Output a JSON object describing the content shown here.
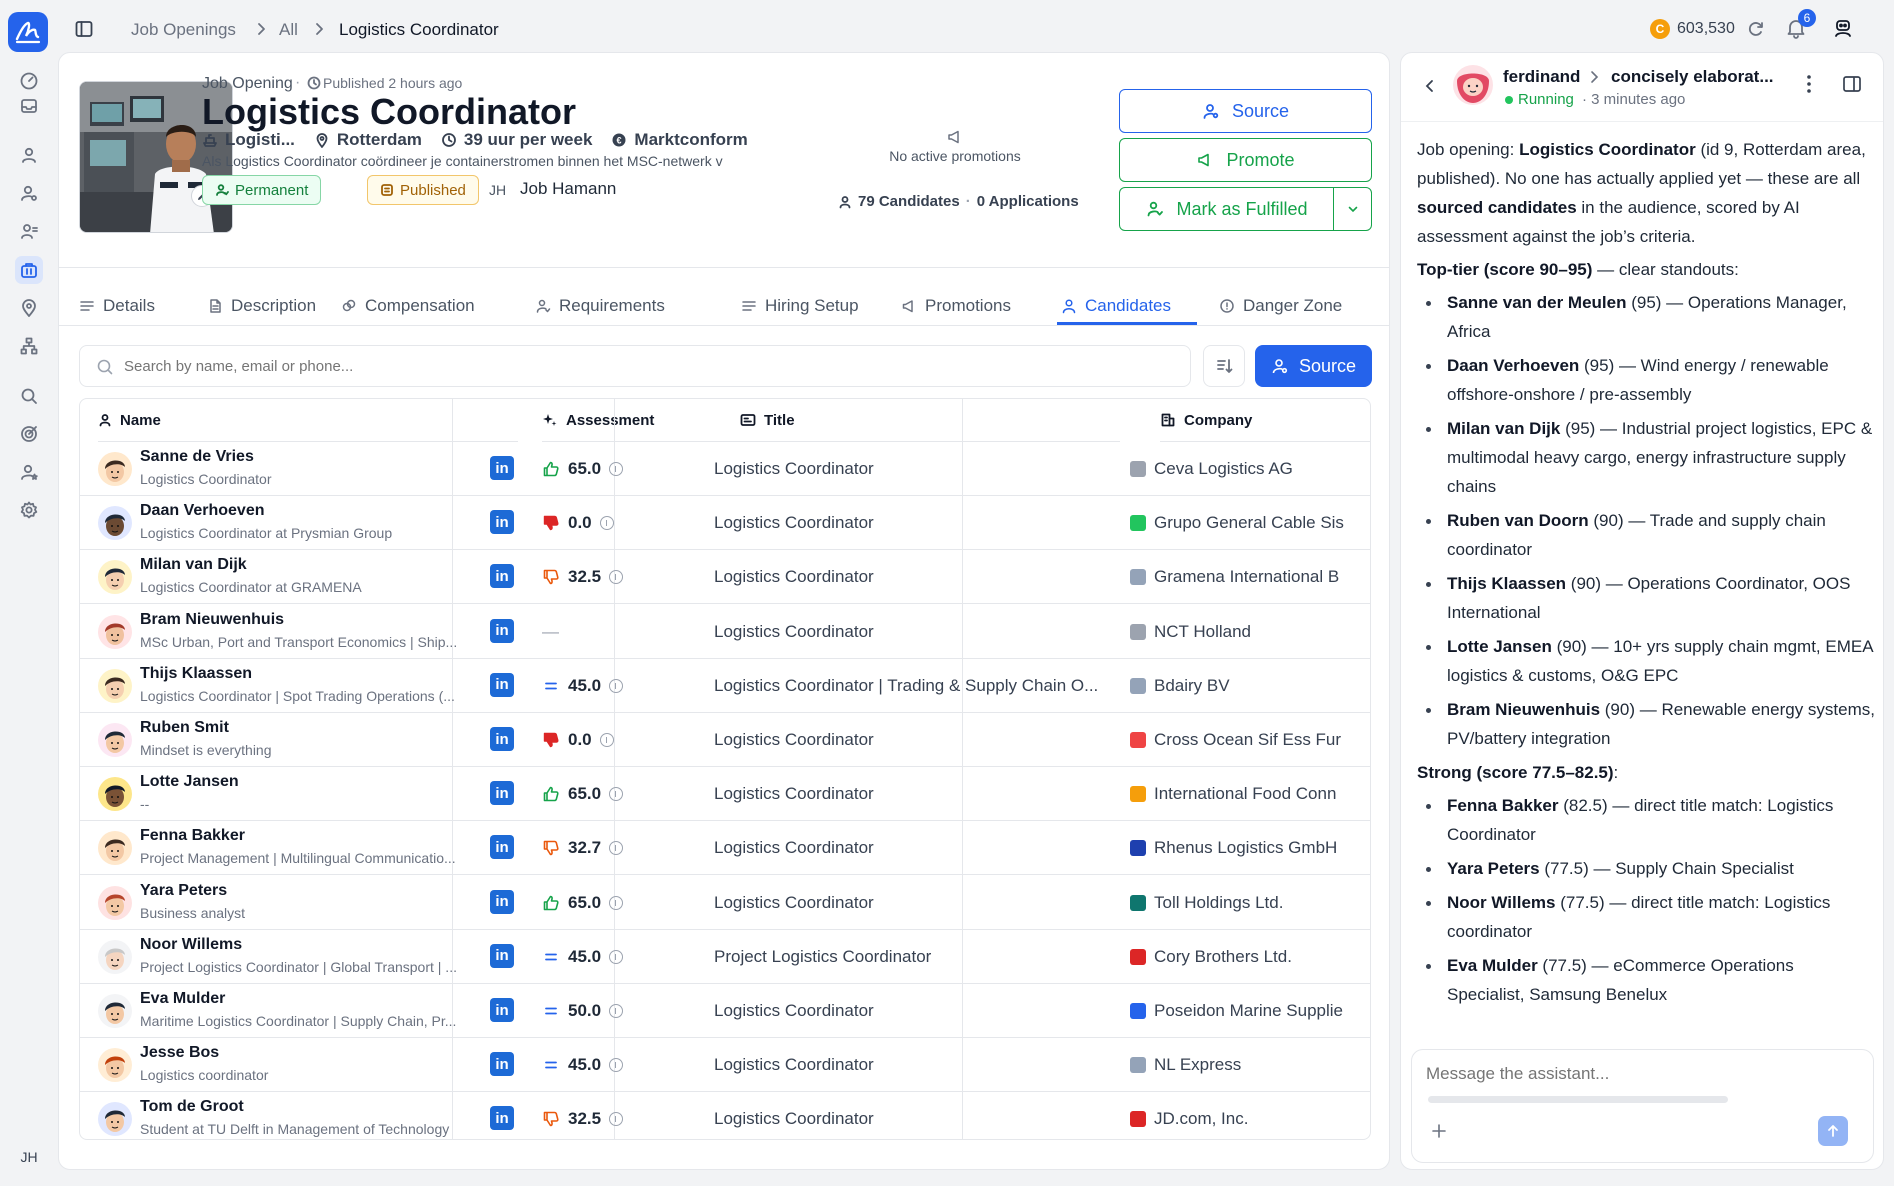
{
  "breadcrumb": {
    "section": "Job Openings",
    "filter": "All",
    "current": "Logistics Coordinator"
  },
  "header_right": {
    "credits": "603,530",
    "notification_count": "6"
  },
  "rail": {
    "user_initials": "JH"
  },
  "job": {
    "kind": "Job Opening",
    "published_ago": "Published 2 hours ago",
    "title": "Logistics Coordinator",
    "department": "Logisti...",
    "location": "Rotterdam",
    "hours": "39 uur per week",
    "salary": "Marktconform",
    "summary": "Als Logistics Coordinator coördineer je containerstromen binnen het MSC-netwerk v",
    "tag_permanent": "Permanent",
    "tag_published": "Published",
    "owner_initials": "JH",
    "owner_name": "Job Hamann"
  },
  "promotions": {
    "status": "No active promotions"
  },
  "counts": {
    "candidates": "79 Candidates",
    "separator": "·",
    "applications": "0 Applications"
  },
  "actions": {
    "source": "Source",
    "promote": "Promote",
    "fulfilled": "Mark as Fulfilled"
  },
  "tabs": [
    {
      "label": "Details",
      "icon": "list-icon"
    },
    {
      "label": "Description",
      "icon": "document-icon"
    },
    {
      "label": "Compensation",
      "icon": "coins-icon"
    },
    {
      "label": "Requirements",
      "icon": "user-check-icon"
    },
    {
      "label": "Hiring Setup",
      "icon": "list-icon"
    },
    {
      "label": "Promotions",
      "icon": "megaphone-icon"
    },
    {
      "label": "Candidates",
      "icon": "user-icon"
    },
    {
      "label": "Danger Zone",
      "icon": "alert-icon"
    }
  ],
  "active_tab": "Candidates",
  "search": {
    "placeholder": "Search by name, email or phone...",
    "source_label": "Source"
  },
  "table": {
    "headers": {
      "name": "Name",
      "assessment": "Assessment",
      "title": "Title",
      "company": "Company"
    },
    "rows": [
      {
        "name": "Sanne de Vries",
        "subtitle": "Logistics Coordinator",
        "rating": "up",
        "score": "65.0",
        "title": "Logistics Coordinator",
        "company": "Ceva Logistics AG",
        "co_color": "#9ca3af"
      },
      {
        "name": "Daan Verhoeven",
        "subtitle": "Logistics Coordinator at Prysmian Group",
        "rating": "down-strong",
        "score": "0.0",
        "title": "Logistics Coordinator",
        "company": "Grupo General Cable Sis",
        "co_color": "#22c55e"
      },
      {
        "name": "Milan van Dijk",
        "subtitle": "Logistics Coordinator at GRAMENA",
        "rating": "down",
        "score": "32.5",
        "title": "Logistics Coordinator",
        "company": "Gramena International B",
        "co_color": "#94a3b8"
      },
      {
        "name": "Bram Nieuwenhuis",
        "subtitle": "MSc Urban, Port and Transport Economics | Ship...",
        "rating": "none",
        "score": "—",
        "title": "Logistics Coordinator",
        "company": "NCT Holland",
        "co_color": "#9ca3af"
      },
      {
        "name": "Thijs Klaassen",
        "subtitle": "Logistics Coordinator | Spot Trading Operations (...",
        "rating": "neutral",
        "score": "45.0",
        "title": "Logistics Coordinator | Trading & Supply Chain O...",
        "company": "Bdairy BV",
        "co_color": "#94a3b8"
      },
      {
        "name": "Ruben Smit",
        "subtitle": "Mindset is everything",
        "rating": "down-strong",
        "score": "0.0",
        "title": "Logistics Coordinator",
        "company": "Cross Ocean Sif Ess Fur",
        "co_color": "#ef4444"
      },
      {
        "name": "Lotte Jansen",
        "subtitle": "--",
        "rating": "up",
        "score": "65.0",
        "title": "Logistics Coordinator",
        "company": "International Food Conn",
        "co_color": "#f59e0b"
      },
      {
        "name": "Fenna Bakker",
        "subtitle": "Project Management | Multilingual Communicatio...",
        "rating": "down",
        "score": "32.7",
        "title": "Logistics Coordinator",
        "company": "Rhenus Logistics GmbH",
        "co_color": "#1e40af"
      },
      {
        "name": "Yara Peters",
        "subtitle": "Business analyst",
        "rating": "up",
        "score": "65.0",
        "title": "Logistics Coordinator",
        "company": "Toll Holdings Ltd.",
        "co_color": "#0f766e"
      },
      {
        "name": "Noor Willems",
        "subtitle": "Project Logistics Coordinator | Global Transport | ...",
        "rating": "neutral",
        "score": "45.0",
        "title": "Project Logistics Coordinator",
        "company": "Cory Brothers Ltd.",
        "co_color": "#dc2626"
      },
      {
        "name": "Eva Mulder",
        "subtitle": "Maritime Logistics Coordinator | Supply Chain, Pr...",
        "rating": "neutral",
        "score": "50.0",
        "title": "Logistics Coordinator",
        "company": "Poseidon Marine Supplie",
        "co_color": "#2563eb"
      },
      {
        "name": "Jesse Bos",
        "subtitle": "Logistics coordinator",
        "rating": "neutral",
        "score": "45.0",
        "title": "Logistics Coordinator",
        "company": "NL Express",
        "co_color": "#94a3b8"
      },
      {
        "name": "Tom de Groot",
        "subtitle": "Student at TU Delft in Management of Technology",
        "rating": "down",
        "score": "32.5",
        "title": "Logistics Coordinator",
        "company": "JD.com, Inc.",
        "co_color": "#dc2626"
      }
    ]
  },
  "assistant": {
    "agent": "ferdinand",
    "thread": "concisely elaborat...",
    "status": "Running",
    "time": "· 3 minutes ago",
    "intro": {
      "a": "Job opening: ",
      "b": "Logistics Coordinator",
      "c": " (id 9, Rotterdam area, published). No one has actually applied yet — these are all ",
      "d": "sourced candidates",
      "e": " in the audience, scored by AI assessment against the job’s criteria."
    },
    "tier1_heading": "Top-tier (score 90–95)",
    "tier1_suffix": " — clear standouts:",
    "tier1": [
      {
        "name": "Sanne van der Meulen",
        "text": " (95) — Operations Manager, Africa"
      },
      {
        "name": "Daan Verhoeven",
        "text": " (95) — Wind energy / renewable offshore-onshore / pre-assembly"
      },
      {
        "name": "Milan van Dijk",
        "text": " (95) — Industrial project logistics, EPC & multimodal heavy cargo, energy infrastructure supply chains"
      },
      {
        "name": "Ruben van Doorn",
        "text": " (90) — Trade and supply chain coordinator"
      },
      {
        "name": "Thijs Klaassen",
        "text": " (90) — Operations Coordinator, OOS International"
      },
      {
        "name": "Lotte Jansen",
        "text": " (90) — 10+ yrs supply chain mgmt, EMEA logistics & customs, O&G EPC"
      },
      {
        "name": "Bram Nieuwenhuis",
        "text": " (90) — Renewable energy systems, PV/battery integration"
      }
    ],
    "tier2_heading": "Strong (score 77.5–82.5)",
    "tier2_suffix": ":",
    "tier2": [
      {
        "name": "Fenna Bakker",
        "text": " (82.5) — direct title match: Logistics Coordinator"
      },
      {
        "name": "Yara Peters",
        "text": " (77.5) — Supply Chain Specialist"
      },
      {
        "name": "Noor Willems",
        "text": " (77.5) — direct title match: Logistics coordinator"
      },
      {
        "name": "Eva Mulder",
        "text": " (77.5) — eCommerce Operations Specialist, Samsung Benelux"
      }
    ],
    "composer_placeholder": "Message the assistant..."
  },
  "colors": {
    "accent": "#2563eb",
    "green": "#16a34a",
    "amber": "#ca8a04",
    "red": "#dc2626"
  }
}
